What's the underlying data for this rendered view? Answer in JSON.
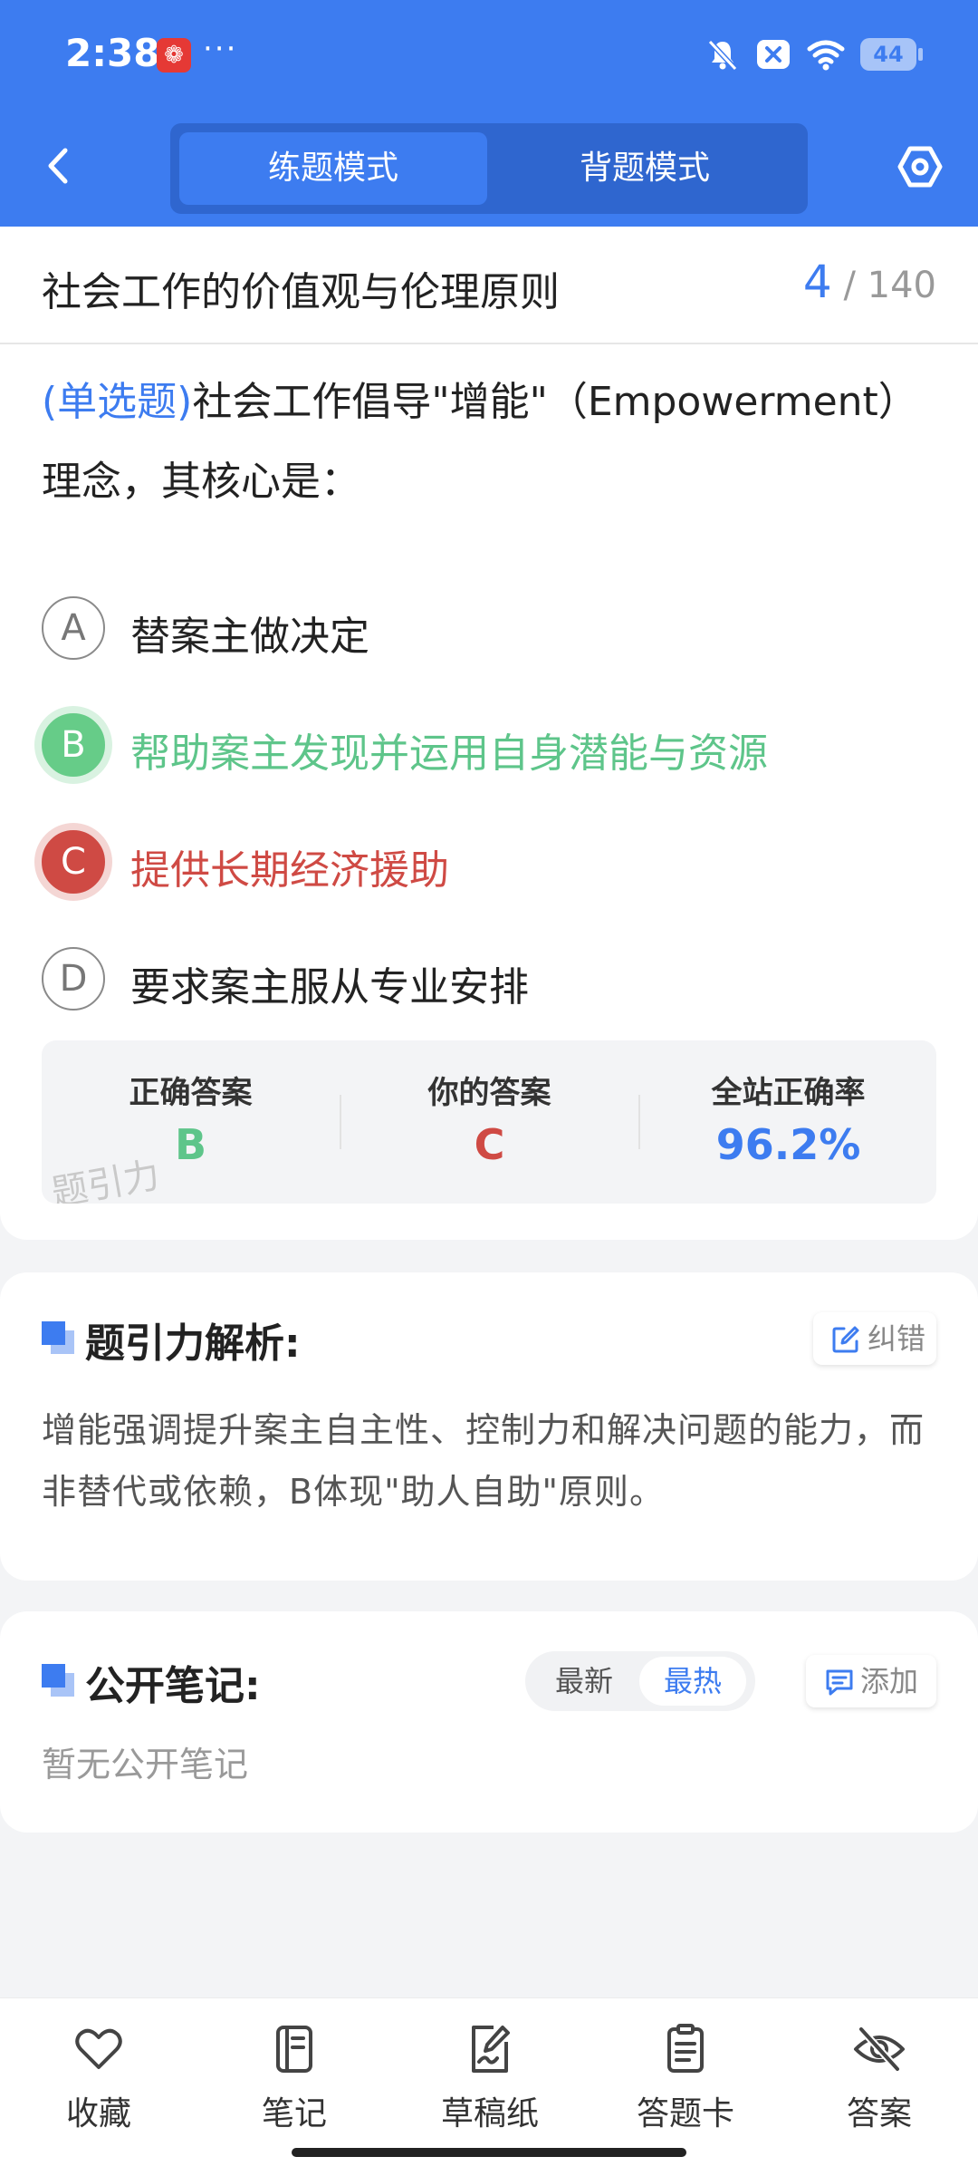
{
  "status_bar": {
    "time": "2:38",
    "app_badge_icon": "netease-music-icon",
    "dots": "···",
    "battery": "44"
  },
  "header": {
    "back_icon": "back-chevron-icon",
    "modes": [
      {
        "label": "练题模式",
        "active": true
      },
      {
        "label": "背题模式",
        "active": false
      }
    ],
    "settings_icon": "settings-hexagon-icon",
    "accent_color": "#3d7cf0"
  },
  "chapter": {
    "title": "社会工作的价值观与伦理原则",
    "current": "4",
    "separator": "/",
    "total": "140"
  },
  "question": {
    "type": "(单选题)",
    "text": "社会工作倡导\"增能\"（Empowerment）理念，其核心是："
  },
  "options": [
    {
      "letter": "A",
      "text": "替案主做决定",
      "state": "normal"
    },
    {
      "letter": "B",
      "text": "帮助案主发现并运用自身潜能与资源",
      "state": "correct"
    },
    {
      "letter": "C",
      "text": "提供长期经济援助",
      "state": "wrong"
    },
    {
      "letter": "D",
      "text": "要求案主服从专业安排",
      "state": "normal"
    }
  ],
  "answer_summary": {
    "correct_label": "正确答案",
    "correct_value": "B",
    "yours_label": "你的答案",
    "yours_value": "C",
    "rate_label": "全站正确率",
    "rate_value": "96.2%",
    "watermark": "题引力",
    "colors": {
      "correct": "#5ec58a",
      "wrong": "#cf4a44",
      "rate": "#3d7cf0"
    }
  },
  "analysis": {
    "title": "题引力解析:",
    "report_label": "纠错",
    "text": "增能强调提升案主自主性、控制力和解决问题的能力，而非替代或依赖，B体现\"助人自助\"原则。"
  },
  "notes": {
    "title": "公开笔记:",
    "sort_latest": "最新",
    "sort_hot": "最热",
    "add_label": "添加",
    "empty_text": "暂无公开笔记"
  },
  "bottom_nav": [
    {
      "label": "收藏",
      "icon": "heart-icon"
    },
    {
      "label": "笔记",
      "icon": "notebook-icon"
    },
    {
      "label": "草稿纸",
      "icon": "draft-paper-icon"
    },
    {
      "label": "答题卡",
      "icon": "answer-card-icon"
    },
    {
      "label": "答案",
      "icon": "eye-off-icon"
    }
  ]
}
